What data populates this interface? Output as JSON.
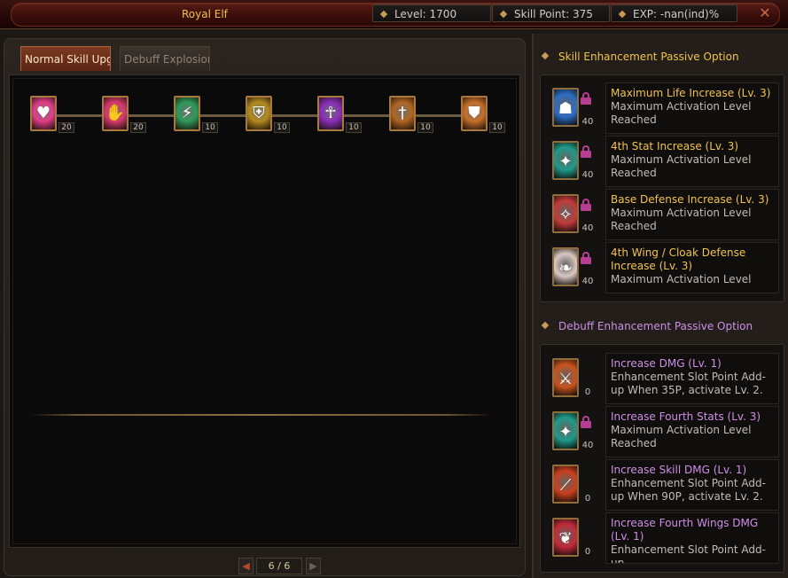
{
  "header": {
    "title": "Royal Elf",
    "level": "Level: 1700",
    "skill_point": "Skill Point: 375",
    "exp": "EXP: -nan(ind)%",
    "close_label": "✕"
  },
  "tabs": [
    {
      "label": "Normal Skill Upgrade",
      "active": true
    },
    {
      "label": "Debuff Explosion",
      "active": false
    }
  ],
  "skill_tree": [
    {
      "icon": "heart-icon",
      "count": "20",
      "color": "#e23e8a"
    },
    {
      "icon": "scroll-hand-icon",
      "count": "20",
      "color": "#d8396e"
    },
    {
      "icon": "lightning-sword-icon",
      "count": "10",
      "color": "#2f9a5a"
    },
    {
      "icon": "golden-armor-icon",
      "count": "10",
      "color": "#b58b1e"
    },
    {
      "icon": "glowing-figure-icon",
      "count": "10",
      "color": "#8a2fb8"
    },
    {
      "icon": "blade-icon",
      "count": "10",
      "color": "#b26622"
    },
    {
      "icon": "shield-icon",
      "count": "10",
      "color": "#c8702a"
    }
  ],
  "pagination": {
    "label": "6 / 6"
  },
  "skill_enhancement": {
    "heading": "Skill Enhancement Passive Option",
    "items": [
      {
        "title": "Maximum Life Increase (Lv. 3)",
        "desc": "Maximum Activation Level Reached",
        "count": "40",
        "icon": "blue-person-icon",
        "color": "#2c6dc4",
        "locked": true
      },
      {
        "title": "4th Stat Increase (Lv. 3)",
        "desc": "Maximum Activation Level Reached",
        "count": "40",
        "icon": "teal-sparkle-icon",
        "color": "#1f9a8a",
        "locked": true
      },
      {
        "title": "Base Defense Increase (Lv. 3)",
        "desc": "Maximum Activation Level Reached",
        "count": "40",
        "icon": "red-card-icon",
        "color": "#c23a3a",
        "locked": true
      },
      {
        "title": "4th Wing / Cloak Defense Increase (Lv. 3)",
        "desc": "Maximum Activation Level",
        "count": "40",
        "icon": "wing-icon",
        "color": "#d9c7c0",
        "locked": true
      }
    ]
  },
  "debuff_enhancement": {
    "heading": "Debuff Enhancement Passive Option",
    "items": [
      {
        "title": "Increase DMG (Lv. 1)",
        "desc": "Enhancement Slot Point Add-up When 35P, activate Lv. 2.",
        "count": "0",
        "icon": "orange-sword-icon",
        "color": "#c9541e",
        "locked": false
      },
      {
        "title": "Increase Fourth Stats (Lv. 3)",
        "desc": "Maximum Activation Level Reached",
        "count": "40",
        "icon": "teal-sparkle-icon",
        "color": "#1f9a8a",
        "locked": true
      },
      {
        "title": "Increase Skill DMG (Lv. 1)",
        "desc": "Enhancement Slot Point Add-up When 90P, activate Lv. 2.",
        "count": "0",
        "icon": "slash-icon",
        "color": "#c9401e",
        "locked": false
      },
      {
        "title": "Increase Fourth Wings DMG (Lv. 1)",
        "desc": "Enhancement Slot Point Add-up",
        "count": "0",
        "icon": "red-wing-icon",
        "color": "#c22a3a",
        "locked": false
      }
    ]
  }
}
